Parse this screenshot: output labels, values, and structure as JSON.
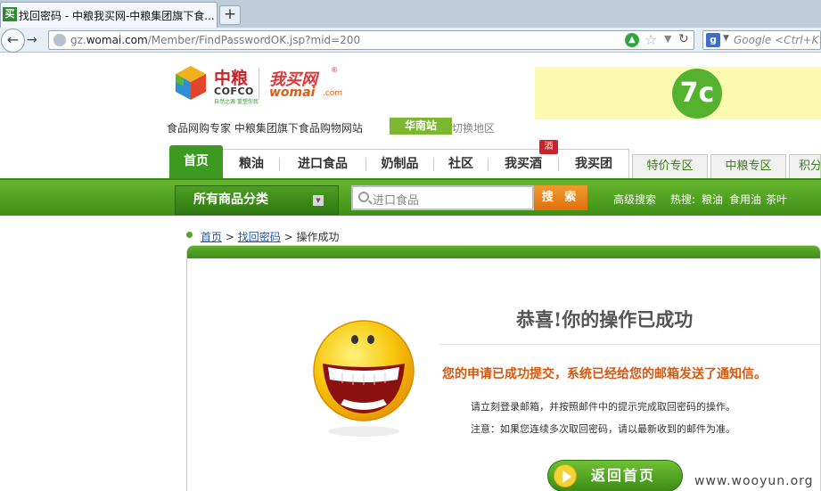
{
  "browser": {
    "tab_title": "找回密码 - 中粮我买网-中粮集团旗下食...",
    "favicon_text": "买",
    "new_tab_label": "+",
    "url_prefix": "gz.",
    "url_domain": "womai.com",
    "url_path": "/Member/FindPasswordOK.jsp?mid=200",
    "search_placeholder": "Google <Ctrl+K>",
    "icons": [
      "back-icon",
      "forward-icon",
      "globe-icon",
      "go-icon",
      "star-icon",
      "dropdown-icon",
      "reload-icon",
      "google-icon"
    ]
  },
  "header": {
    "cofco_cn": "中粮",
    "cofco_en": "COFCO",
    "cofco_slogan": "自然之源 重塑你我",
    "womai_cn": "我买网",
    "womai_reg": "®",
    "womai_en": "womai",
    "womai_com": ".com",
    "banner_text": "7c",
    "tagline": "食品网购专家 中粮集团旗下食品购物网站",
    "region": "华南站",
    "region_switch": "切换地区"
  },
  "nav": {
    "home": "首页",
    "items": [
      "粮油",
      "进口食品",
      "奶制品",
      "社区",
      "我买酒",
      "我买团"
    ],
    "badge": "酒",
    "zones": [
      "特价专区",
      "中粮专区",
      "积分"
    ]
  },
  "toolbar": {
    "category_label": "所有商品分类",
    "search_placeholder": "进口食品",
    "search_button": "搜 索",
    "advanced_search": "高级搜索",
    "hot_label": "热搜:",
    "hot_items": [
      "粮油",
      "食用油",
      "茶叶"
    ]
  },
  "breadcrumb": {
    "home": "首页",
    "find_password": "找回密码",
    "sep": ">",
    "current": "操作成功"
  },
  "content": {
    "title": "恭喜!你的操作已成功",
    "message": "您的申请已成功提交，系统已经给您的邮箱发送了通知信。",
    "info1": "请立刻登录邮箱，并按照邮件中的提示完成取回密码的操作。",
    "info2": "注意：如果您连续多次取回密码，请以最新收到的邮件为准。",
    "home_button": "返回首页"
  },
  "watermark": "www.wooyun.org",
  "colors": {
    "brand_green": "#3d9a20",
    "accent_orange": "#e06f0c",
    "brand_red": "#c8242b",
    "message_orange": "#d6580f"
  }
}
